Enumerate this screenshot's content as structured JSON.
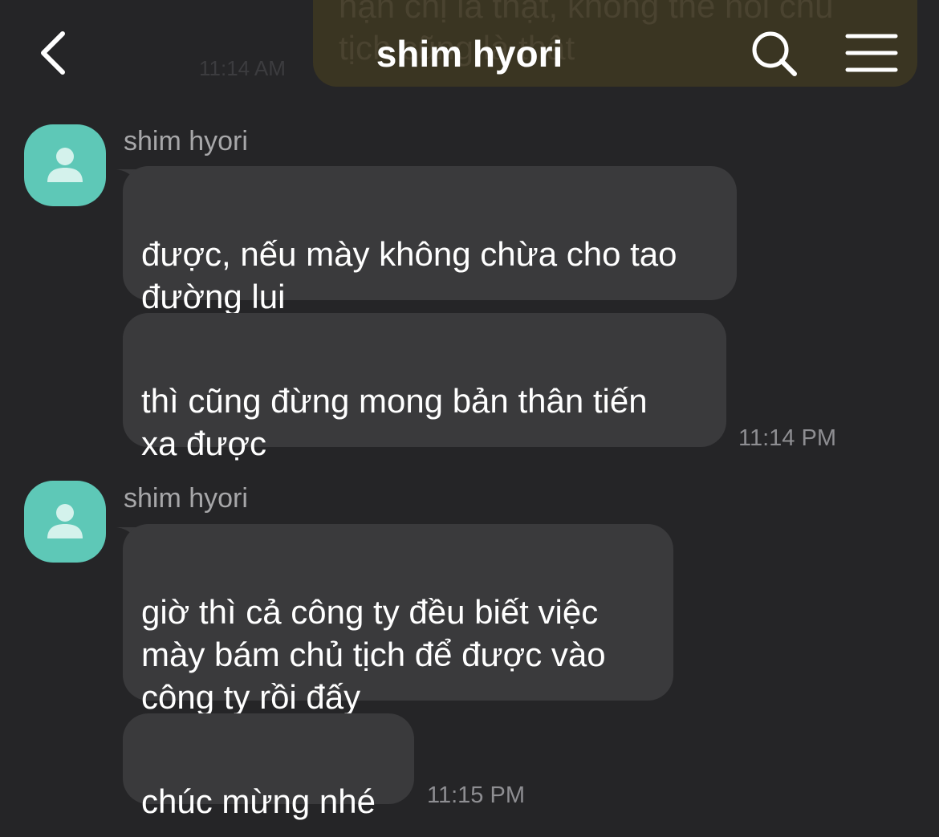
{
  "previous_message": {
    "text": "hạn chị là thật, không thể nói chủ\ntịch cũng là thật",
    "time": "11:14 AM"
  },
  "header": {
    "title": "shim hyori",
    "back_icon": "chevron-left-icon",
    "search_icon": "search-icon",
    "menu_icon": "hamburger-menu-icon"
  },
  "groups": [
    {
      "sender": "shim hyori",
      "messages": [
        "được, nếu mày không chừa cho tao\nđường lui",
        "thì cũng đừng mong bản thân tiến\nxa được"
      ],
      "time": "11:14 PM"
    },
    {
      "sender": "shim hyori",
      "messages": [
        "giờ thì cả công ty đều biết việc\nmày bám chủ tịch để được vào\ncông ty rồi đấy",
        "chúc mừng nhé"
      ],
      "time": "11:15 PM"
    }
  ],
  "colors": {
    "background": "#252527",
    "incoming_bubble": "#3a3a3c",
    "avatar": "#5ec8b7",
    "outgoing_bubble": "#3a3522"
  }
}
